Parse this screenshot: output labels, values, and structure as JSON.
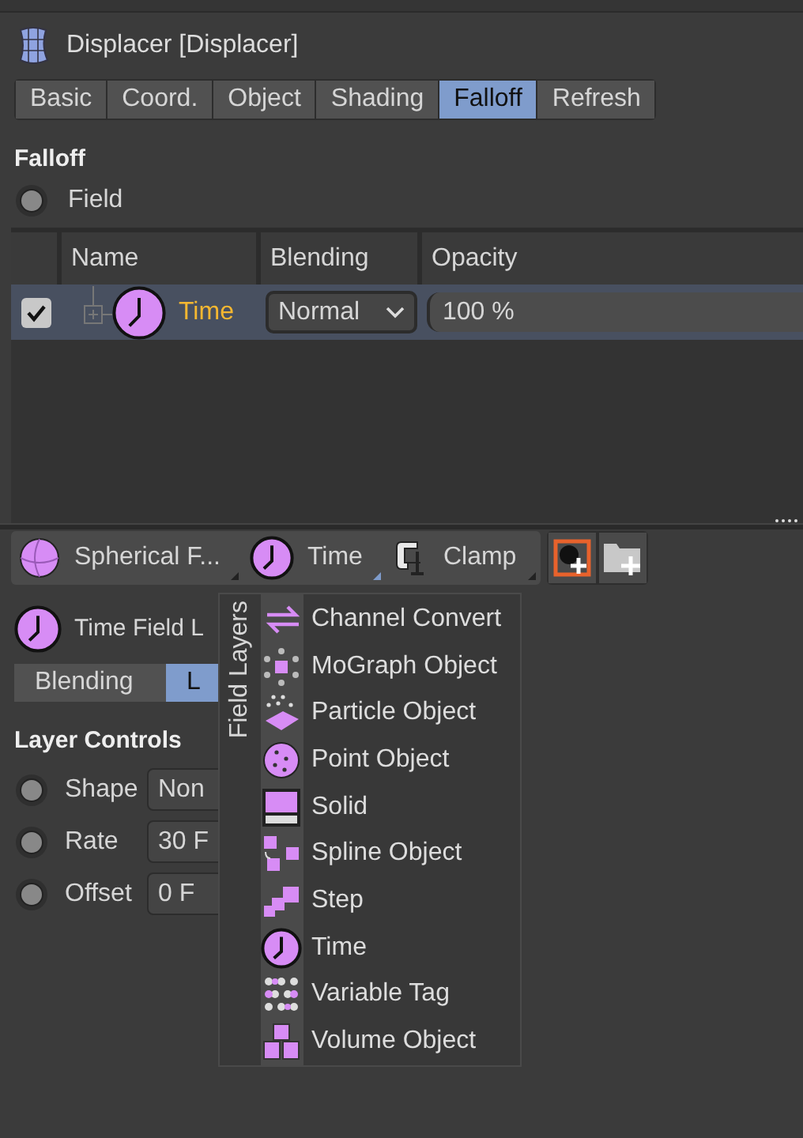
{
  "header": {
    "title": "Displacer [Displacer]"
  },
  "tabs": [
    {
      "label": "Basic",
      "selected": false
    },
    {
      "label": "Coord.",
      "selected": false
    },
    {
      "label": "Object",
      "selected": false
    },
    {
      "label": "Shading",
      "selected": false
    },
    {
      "label": "Falloff",
      "selected": true
    },
    {
      "label": "Refresh",
      "selected": false
    }
  ],
  "section_title": "Falloff",
  "field_option": {
    "label": "Field",
    "on": false
  },
  "table": {
    "columns": [
      "Name",
      "Blending",
      "Opacity"
    ],
    "rows": [
      {
        "enabled": true,
        "name": "Time",
        "blending": "Normal",
        "opacity": "100 %",
        "selected": true
      }
    ]
  },
  "toolbar": [
    {
      "label": "Spherical F..."
    },
    {
      "label": "Time"
    },
    {
      "label": "Clamp"
    }
  ],
  "layer_title": "Time Field L",
  "sub_tabs": [
    {
      "label": "Blending",
      "selected": false
    },
    {
      "label": "L",
      "selected": true
    }
  ],
  "layer_controls": {
    "title": "Layer Controls",
    "rows": [
      {
        "label": "Shape",
        "value": "Non",
        "on": false
      },
      {
        "label": "Rate",
        "value": "30 F",
        "on": false
      },
      {
        "label": "Offset",
        "value": "0 F",
        "on": false
      }
    ]
  },
  "menu": {
    "title": "Field Layers",
    "items": [
      "Channel Convert",
      "MoGraph Object",
      "Particle Object",
      "Point Object",
      "Solid",
      "Spline Object",
      "Step",
      "Time",
      "Variable Tag",
      "Volume Object"
    ]
  }
}
